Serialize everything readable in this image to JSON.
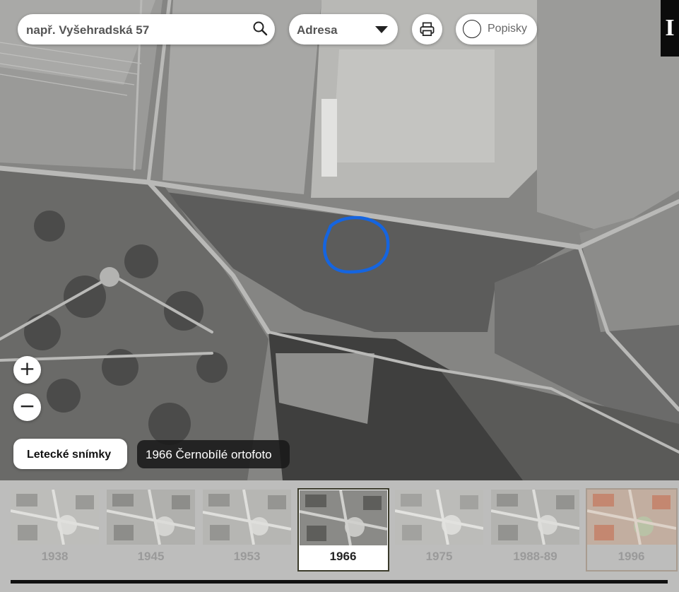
{
  "search": {
    "placeholder": "např. Vyšehradská 57",
    "icon": "search-icon"
  },
  "search_type": {
    "selected": "Adresa"
  },
  "print": {
    "icon": "printer-icon"
  },
  "labels_toggle": {
    "label": "Popisky",
    "checked": false
  },
  "corner_badge": {
    "text": "I"
  },
  "zoom": {
    "in_label": "+",
    "out_label": "−"
  },
  "layer_button": {
    "label": "Letecké snímky"
  },
  "current_layer": {
    "label": "1966 Černobílé ortofoto"
  },
  "timeline": {
    "selected": "1966",
    "years": [
      "1938",
      "1945",
      "1953",
      "1966",
      "1975",
      "1988-89",
      "1996"
    ]
  },
  "colors": {
    "marker": "#1565e0",
    "selected_border": "#3a3a2a"
  }
}
